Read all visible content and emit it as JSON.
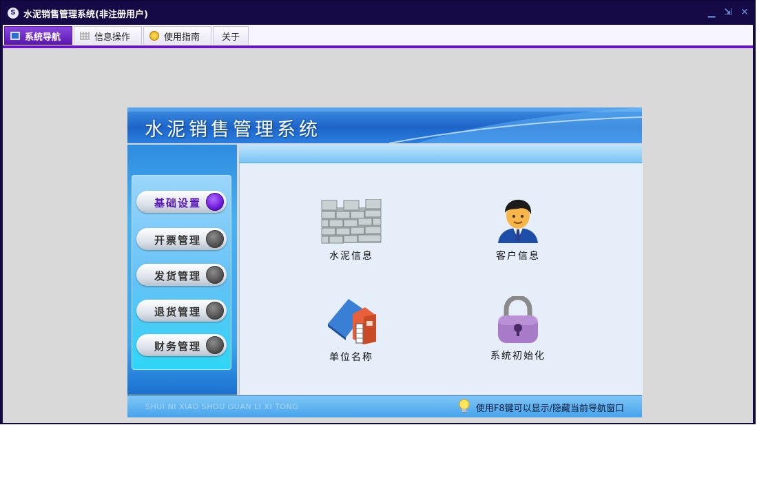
{
  "window": {
    "title": "水泥销售管理系统(非注册用户)",
    "app_icon_glyph": "S",
    "controls": {
      "minimize": "▁",
      "restore": "⇲",
      "close": "✕"
    }
  },
  "menu": {
    "tabs": [
      {
        "label": "系统导航",
        "icon": "monitor-icon",
        "active": true
      },
      {
        "label": "信息操作",
        "icon": "grid-icon",
        "active": false
      },
      {
        "label": "使用指南",
        "icon": "help-icon",
        "active": false
      },
      {
        "label": "关于",
        "icon": "",
        "active": false
      }
    ]
  },
  "banner": {
    "title": "水泥销售管理系统"
  },
  "nav": {
    "items": [
      {
        "label": "基础设置",
        "active": true
      },
      {
        "label": "开票管理",
        "active": false
      },
      {
        "label": "发货管理",
        "active": false
      },
      {
        "label": "退货管理",
        "active": false
      },
      {
        "label": "财务管理",
        "active": false
      }
    ]
  },
  "tiles": [
    {
      "label": "水泥信息",
      "icon": "brick-wall-icon"
    },
    {
      "label": "客户信息",
      "icon": "customer-icon"
    },
    {
      "label": "单位名称",
      "icon": "building-icon"
    },
    {
      "label": "系统初始化",
      "icon": "lock-icon"
    }
  ],
  "footer": {
    "pinyin": "SHUI NI XIAO SHOU GUAN LI XI TONG",
    "tip": "使用F8键可以显示/隐藏当前导航窗口"
  },
  "colors": {
    "accent": "#6a14c8",
    "title_bar": "#150a45",
    "banner": "#1d64c8"
  }
}
